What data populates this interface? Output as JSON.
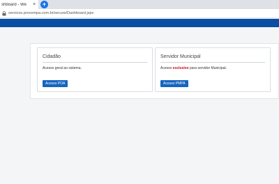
{
  "browser": {
    "tab_title": "shboard - We",
    "tab_close": "×",
    "new_tab": "+",
    "url": "servicos.procempa.com.br/secure/Dashboard.jspx"
  },
  "cards": [
    {
      "title": "Cidadão",
      "text": "Acesso geral ao sistema.",
      "button": "Acesso POA"
    },
    {
      "title": "Servidor Municipal",
      "text_before": "Acesso ",
      "text_emphasis": "exclusivo",
      "text_after": " para servidor Municipal.",
      "button": "Acesso PMPA"
    }
  ],
  "colors": {
    "nav": "#0a4ea3",
    "button": "#1565c0",
    "emphasis": "#d0021b"
  }
}
